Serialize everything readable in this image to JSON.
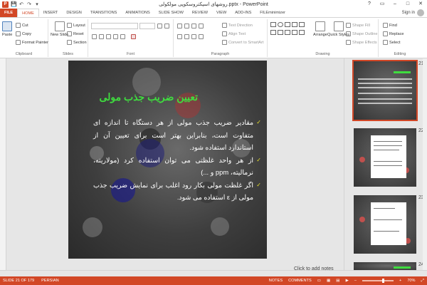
{
  "app": {
    "window_title": "روشهای اسپکتروسکوپی مولکولی.pptx - PowerPoint",
    "window_controls": [
      "?",
      "▭",
      "–",
      "□",
      "✕"
    ],
    "accent_color": "#d24726"
  },
  "qat": {
    "save_icon": "💾",
    "undo_icon": "↶",
    "redo_icon": "↷",
    "customize_icon": "▾"
  },
  "tabs": [
    "FILE",
    "HOME",
    "INSERT",
    "DESIGN",
    "TRANSITIONS",
    "ANIMATIONS",
    "SLIDE SHOW",
    "REVIEW",
    "VIEW",
    "ADD-INS",
    "FILEminimizer"
  ],
  "active_tab": "HOME",
  "signin": {
    "label": "Sign in"
  },
  "ribbon": {
    "clipboard": {
      "label": "Clipboard",
      "paste": "Paste",
      "cut": "Cut",
      "copy": "Copy",
      "format_painter": "Format Painter"
    },
    "slides": {
      "label": "Slides",
      "new_slide": "New Slide",
      "layout": "Layout",
      "reset": "Reset",
      "section": "Section"
    },
    "font": {
      "label": "Font"
    },
    "paragraph": {
      "label": "Paragraph",
      "text_direction": "Text Direction",
      "align_text": "Align Text",
      "convert_smartart": "Convert to SmartArt"
    },
    "drawing": {
      "label": "Drawing",
      "arrange": "Arrange",
      "quick_styles": "Quick Styles",
      "shape_fill": "Shape Fill",
      "shape_outline": "Shape Outline",
      "shape_effects": "Shape Effects"
    },
    "editing": {
      "label": "Editing",
      "find": "Find",
      "replace": "Replace",
      "select": "Select"
    }
  },
  "slide": {
    "title": "تعیین ضریب جذب مولی",
    "bullets": [
      "مقادیر ضریب جذب مولی از هر دستگاه تا اندازه ای متفاوت است، بنابراین بهتر است برای تعیین آن از استاندارد استفاده شود.",
      "از هر واحد غلظتی می توان استفاده کرد (مولاریته، نرمالیته، ppm و ...)",
      "اگر غلظت مولی بکار رود اغلب برای نمایش ضریب جذب مولی از ε استفاده می شود."
    ],
    "check_icon": "✓",
    "number": "21",
    "colors": {
      "title": "#3fdc3f",
      "check": "#e7e02a",
      "text": "#ffffff"
    }
  },
  "notes_hint": "Click to add notes",
  "thumbnails": [
    {
      "number": "21",
      "selected": true
    },
    {
      "number": "22",
      "selected": false
    },
    {
      "number": "23",
      "selected": false
    },
    {
      "number": "24",
      "selected": false
    }
  ],
  "status": {
    "slide_info": "SLIDE 21 OF 179",
    "language": "PERSIAN",
    "notes": "NOTES",
    "comments": "COMMENTS",
    "zoom": "70%",
    "zoom_level": 0.7
  }
}
